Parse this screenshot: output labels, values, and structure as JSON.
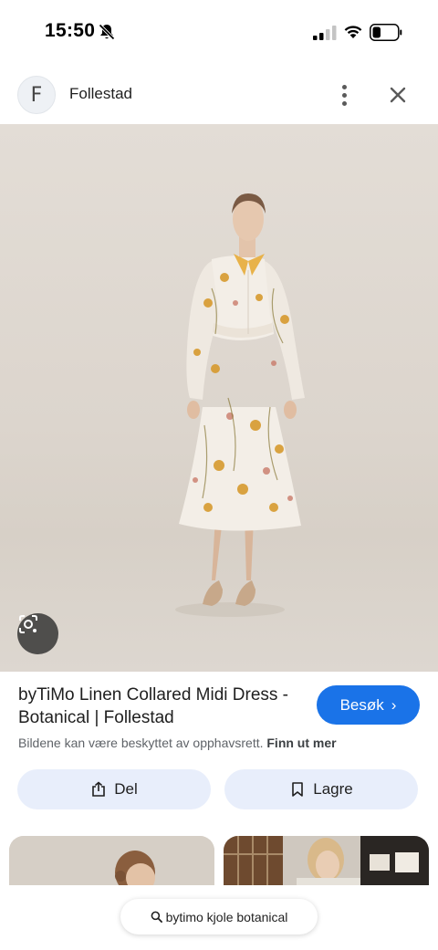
{
  "status_bar": {
    "time": "15:50",
    "icons": [
      "bell-slash-icon",
      "signal-icon",
      "wifi-icon",
      "battery-icon"
    ]
  },
  "header": {
    "avatar_letter": "F",
    "site_name": "Follestad",
    "icons": [
      "more-vert-icon",
      "close-icon"
    ]
  },
  "image": {
    "icons": [
      "lens-icon"
    ]
  },
  "product": {
    "title": "byTiMo Linen Collared Midi Dress - Botanical | Follestad",
    "visit_label": "Besøk",
    "visit_chevron": "›",
    "copyright_text": "Bildene kan være beskyttet av opphavsrett.",
    "learn_more": "Finn ut mer"
  },
  "actions": {
    "share_label": "Del",
    "save_label": "Lagre"
  },
  "search": {
    "query": "bytimo kjole botanical"
  },
  "colors": {
    "accent": "#1a73e8",
    "action_bg": "#e8eefb",
    "secondary_text": "#5f6368"
  }
}
